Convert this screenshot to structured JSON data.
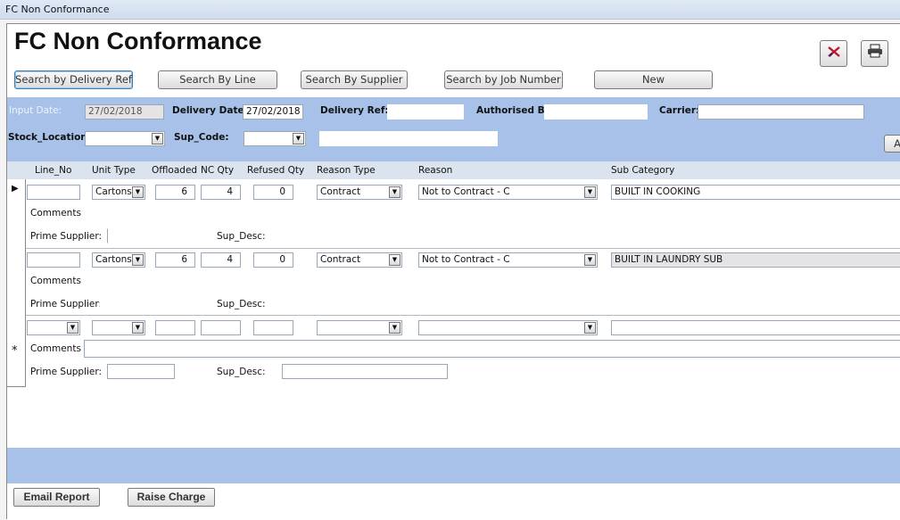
{
  "window": {
    "title": "FC Non Conformance"
  },
  "page": {
    "title": "FC Non Conformance"
  },
  "search_buttons": [
    "Search by Delivery Ref",
    "Search By Line",
    "Search By Supplier",
    "Search by Job Number",
    "New"
  ],
  "header_icons": {
    "delete": "delete-record-icon",
    "print": "printer-icon"
  },
  "filters": {
    "input_date_label": "Input Date:",
    "input_date_value": "27/02/2018",
    "delivery_date_label": "Delivery Date:",
    "delivery_date_value": "27/02/2018",
    "delivery_ref_label": "Delivery Ref:",
    "delivery_ref_value": "",
    "authorised_by_label": "Authorised By:",
    "authorised_by_value": "",
    "carrier_label": "Carrier:",
    "carrier_value": "",
    "stock_location_label": "Stock_Location:",
    "stock_location_value": "",
    "sup_code_label": "Sup_Code:",
    "sup_code_value": "",
    "sup_name_value": "",
    "right_button_label": "A"
  },
  "columns": [
    "Line_No",
    "Unit Type",
    "Offloaded",
    "NC Qty",
    "Refused Qty",
    "Reason Type",
    "Reason",
    "Sub Category"
  ],
  "labels": {
    "comments": "Comments",
    "prime_supplier": "Prime Supplier:",
    "sup_desc": "Sup_Desc:"
  },
  "rows": [
    {
      "line_no": "",
      "unit_type": "Cartons",
      "offloaded": "6",
      "nc_qty": "4",
      "refused_qty": "0",
      "reason_type": "Contract",
      "reason": "Not to Contract - C",
      "sub_category": "BUILT IN COOKING",
      "comments": "",
      "prime_supplier": "",
      "sup_desc": ""
    },
    {
      "line_no": "",
      "unit_type": "Cartons",
      "offloaded": "6",
      "nc_qty": "4",
      "refused_qty": "0",
      "reason_type": "Contract",
      "reason": "Not to Contract - C",
      "sub_category": "BUILT IN LAUNDRY SUB",
      "comments": "",
      "prime_supplier": "",
      "sup_desc": ""
    },
    {
      "line_no": "",
      "unit_type": "",
      "offloaded": "",
      "nc_qty": "",
      "refused_qty": "",
      "reason_type": "",
      "reason": "",
      "sub_category": "",
      "comments": "",
      "prime_supplier": "",
      "sup_desc": ""
    }
  ],
  "record_selectors": {
    "current": "▶",
    "new": "*"
  },
  "footer": {
    "email_report": "Email Report",
    "raise_charge": "Raise Charge"
  },
  "colors": {
    "band": "#a7c1e8",
    "column_header": "#dbe3ee"
  }
}
